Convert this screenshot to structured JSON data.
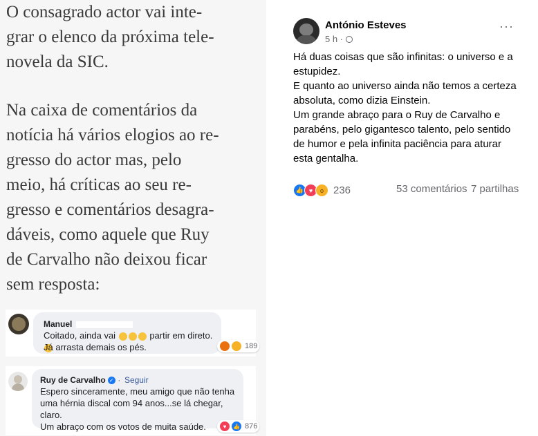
{
  "article": {
    "para1": "O consagrado actor vai inte-\ngrar o elenco da próxima tele-\nnovela da SIC.",
    "para2": "Na caixa de comentários da\nnotícia há vários elogios ao re-\ngresso do actor mas, pelo\nmeio, há críticas ao seu re-\ngresso e comentários desagra-\ndáveis, como aquele que Ruy\nde Carvalho não deixou ficar\nsem resposta:"
  },
  "comments": [
    {
      "author": "Manuel",
      "line1_a": "Coitado, ainda vai",
      "line1_b": "partir em direto.",
      "line2": "Já arrasta demais os pés.",
      "reaction_count": "189"
    },
    {
      "author": "Ruy de Carvalho",
      "follow": "Seguir",
      "text": "Espero sinceramente, meu amigo que não tenha\numa hérnia discal com 94 anos...se lá chegar, claro.\nUm abraço com os votos de muita saúde.",
      "reaction_count": "876"
    }
  ],
  "post": {
    "author": "António Esteves",
    "time": "5 h ·",
    "more": "···",
    "body": [
      "Há duas coisas que são infinitas: o universo e a estupidez.",
      "E quanto ao universo ainda não temos a certeza absoluta, como dizia Einstein.",
      "Um grande abraço para o Ruy de Carvalho e parabéns, pelo gigantesco talento, pelo sentido de humor e pela infinita paciência para aturar esta gentalha."
    ],
    "reaction_count": "236",
    "comments": "53 comentários",
    "shares": "7 partilhas"
  },
  "icons": {
    "like": "like-icon",
    "love": "love-icon",
    "wow": "wow-icon",
    "sad": "sad-icon",
    "angry": "angry-icon",
    "verified": "verified-badge-icon",
    "globe": "globe-icon"
  },
  "colors": {
    "facebook_blue": "#1877f2",
    "link_blue": "#385898",
    "love_red": "#f33e58",
    "reaction_yellow": "#f7b125"
  }
}
